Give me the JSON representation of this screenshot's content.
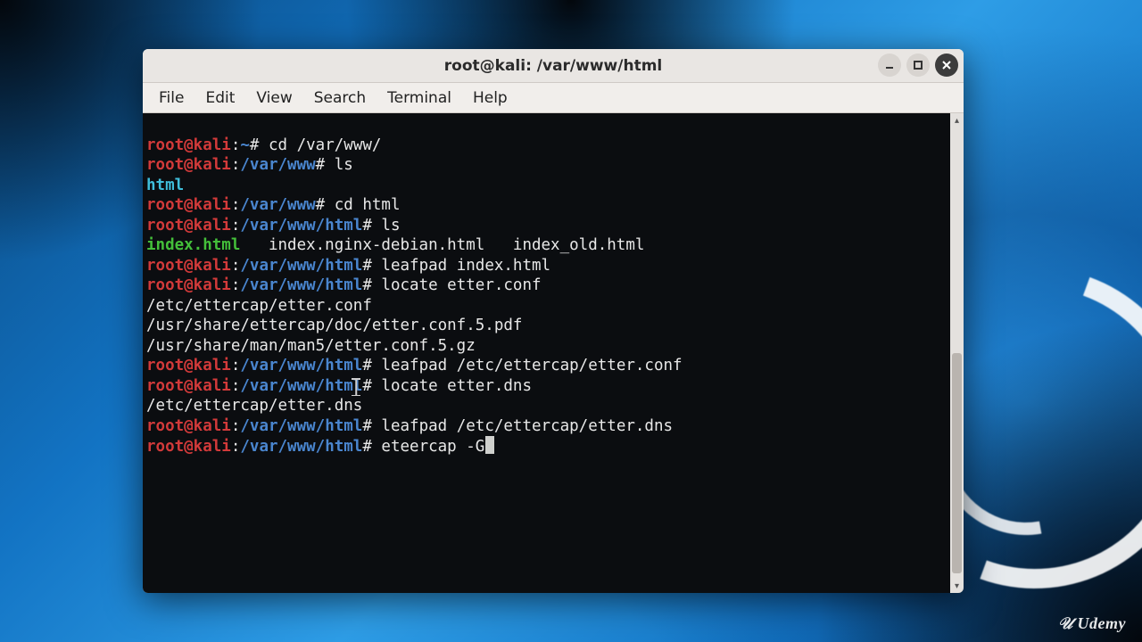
{
  "window": {
    "title": "root@kali: /var/www/html",
    "menu": {
      "file": "File",
      "edit": "Edit",
      "view": "View",
      "search": "Search",
      "terminal": "Terminal",
      "help": "Help"
    }
  },
  "prompt": {
    "user_host": "root@kali",
    "sep": ":",
    "hash": "# ",
    "tilde": "~",
    "p_www": "/var/www",
    "p_html": "/var/www/html"
  },
  "lines": {
    "cmd_cd_www": "cd /var/www/",
    "cmd_ls1": "ls",
    "out_html": "html",
    "cmd_cd_html": "cd html",
    "cmd_ls2": "ls",
    "out_index_html": "index.html",
    "out_index_nginx": "index.nginx-debian.html",
    "out_index_old": "index_old.html",
    "cmd_leafpad_index": "leafpad index.html",
    "cmd_locate_conf": "locate etter.conf",
    "out_conf_1": "/etc/ettercap/etter.conf",
    "out_conf_2": "/usr/share/ettercap/doc/etter.conf.5.pdf",
    "out_conf_3": "/usr/share/man/man5/etter.conf.5.gz",
    "cmd_leafpad_conf": "leafpad /etc/ettercap/etter.conf",
    "cmd_locate_dns": "locate etter.dns",
    "out_dns_1": "/etc/ettercap/etter.dns",
    "cmd_leafpad_dns": "leafpad /etc/ettercap/etter.dns",
    "cmd_eteercap": "eteercap -G"
  },
  "brand": {
    "udemy": "Udemy"
  }
}
